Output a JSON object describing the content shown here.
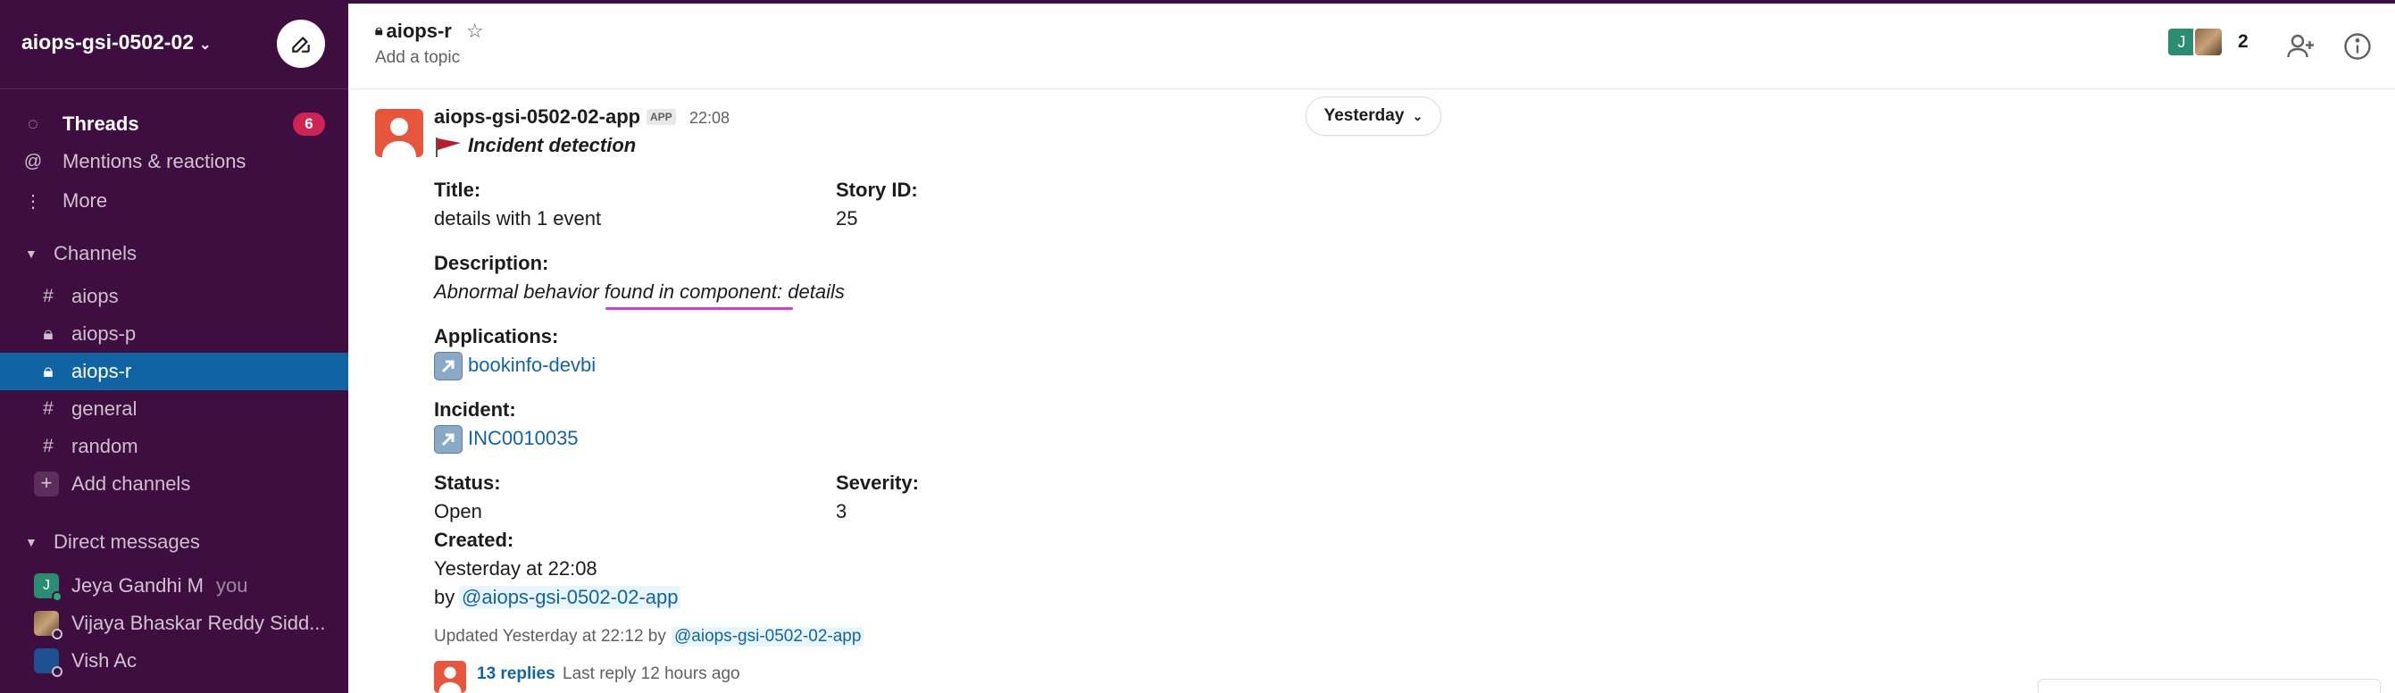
{
  "workspace": {
    "name": "aiops-gsi-0502-02"
  },
  "sidebar": {
    "nav": [
      {
        "label": "Threads",
        "badge": "6",
        "icon": "threads-icon"
      },
      {
        "label": "Mentions & reactions",
        "icon": "at-icon"
      },
      {
        "label": "More",
        "icon": "more-vertical-icon"
      }
    ],
    "channels_section": "Channels",
    "channels": [
      {
        "label": "aiops",
        "type": "public"
      },
      {
        "label": "aiops-p",
        "type": "private"
      },
      {
        "label": "aiops-r",
        "type": "private",
        "active": true
      },
      {
        "label": "general",
        "type": "public"
      },
      {
        "label": "random",
        "type": "public"
      }
    ],
    "add_channels": "Add channels",
    "dm_section": "Direct messages",
    "dms": [
      {
        "label": "Jeya Gandhi M",
        "suffix": "you",
        "initial": "J"
      },
      {
        "label": "Vijaya Bhaskar Reddy Sidd..."
      },
      {
        "label": "Vish Ac"
      }
    ]
  },
  "header": {
    "channel": "aiops-r",
    "topic": "Add a topic",
    "member_initial": "J",
    "member_count": "2"
  },
  "message": {
    "sender": "aiops-gsi-0502-02-app",
    "app_tag": "APP",
    "time": "22:08",
    "date_divider": "Yesterday",
    "heading": "Incident detection",
    "title_label": "Title",
    "title_value": "details with 1 event",
    "story_label": "Story ID",
    "story_value": "25",
    "desc_label": "Description",
    "desc_value": "Abnormal behavior found in component: details",
    "apps_label": "Applications",
    "apps_value": "bookinfo-devbi",
    "incident_label": "Incident",
    "incident_value": "INC0010035",
    "status_label": "Status",
    "status_value": "Open",
    "severity_label": "Severity",
    "severity_value": "3",
    "created_label": "Created",
    "created_value": "Yesterday at 22:08",
    "by_prefix": "by",
    "by_mention": "@aiops-gsi-0502-02-app",
    "updated_text": "Updated Yesterday at 22:12 by",
    "updated_mention": "@aiops-gsi-0502-02-app",
    "replies": "13 replies",
    "last_reply": "Last reply 12 hours ago"
  },
  "colors": {
    "sidebar_bg": "#3f0e40",
    "active_channel": "#1164a3",
    "badge": "#cd2553",
    "link": "#1264a3",
    "annotation_underline": "#d63ad3"
  }
}
